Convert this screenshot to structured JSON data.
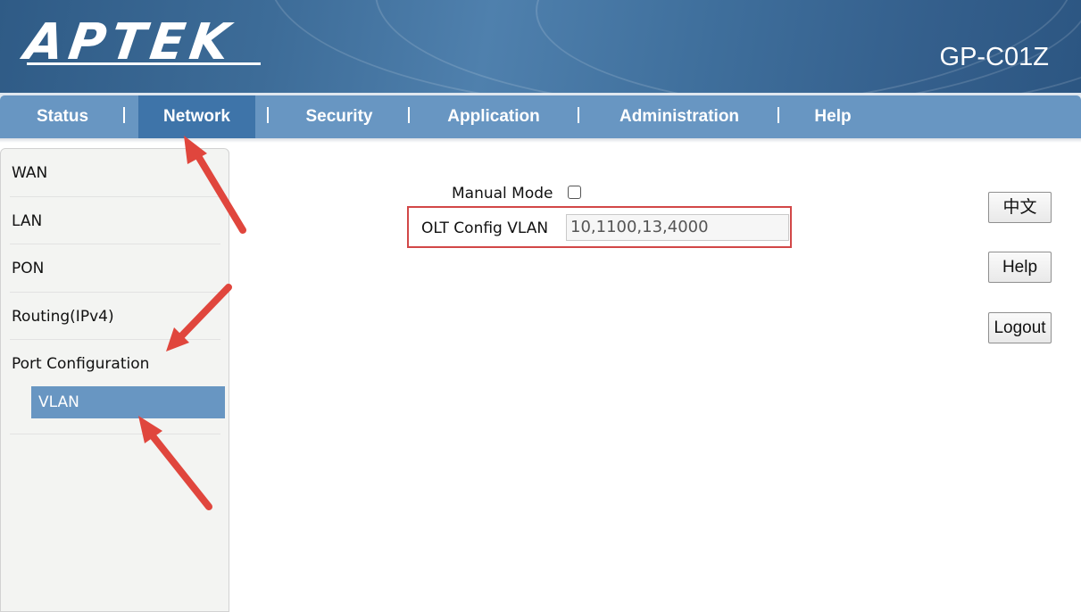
{
  "header": {
    "logo_text": "APTEK",
    "model": "GP-C01Z"
  },
  "nav": {
    "items": [
      {
        "label": "Status"
      },
      {
        "label": "Network"
      },
      {
        "label": "Security"
      },
      {
        "label": "Application"
      },
      {
        "label": "Administration"
      },
      {
        "label": "Help"
      }
    ],
    "active": "Network"
  },
  "sidebar": {
    "items": [
      {
        "label": "WAN"
      },
      {
        "label": "LAN"
      },
      {
        "label": "PON"
      },
      {
        "label": "Routing(IPv4)"
      },
      {
        "label": "Port Configuration"
      }
    ],
    "sub_item": {
      "label": "VLAN"
    }
  },
  "form": {
    "manual_mode_label": "Manual Mode",
    "manual_mode_checked": false,
    "olt_label": "OLT Config VLAN",
    "olt_value": "10,1100,13,4000"
  },
  "buttons": {
    "language": "中文",
    "help": "Help",
    "logout": "Logout"
  },
  "colors": {
    "nav_bar": "#6896c2",
    "nav_active": "#3e74a9",
    "highlight_box": "#d24747",
    "arrow": "#e0463d"
  },
  "annotations": [
    {
      "type": "arrow",
      "target": "nav-network",
      "icon": "red-arrow-icon"
    },
    {
      "type": "arrow",
      "target": "sidebar-port-configuration",
      "icon": "red-arrow-icon"
    },
    {
      "type": "arrow",
      "target": "sidebar-vlan",
      "icon": "red-arrow-icon"
    },
    {
      "type": "box",
      "target": "olt-config-vlan-row"
    }
  ]
}
